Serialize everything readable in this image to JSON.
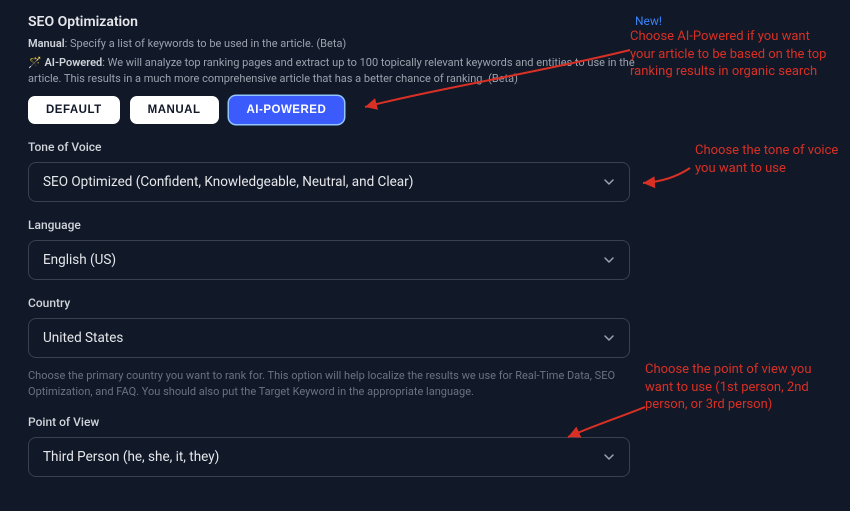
{
  "header": {
    "title": "SEO Optimization",
    "new_badge": "New!"
  },
  "descriptions": {
    "manual_label": "Manual",
    "manual_text": ": Specify a list of keywords to be used in the article. (Beta)",
    "ai_emoji": "🪄",
    "ai_label": "AI-Powered",
    "ai_text": ": We will analyze top ranking pages and extract up to 100 topically relevant keywords and entities to use in the article. This results in a much more comprehensive article that has a better chance of ranking. (Beta)"
  },
  "tabs": {
    "default": "DEFAULT",
    "manual": "MANUAL",
    "ai": "AI-POWERED"
  },
  "fields": {
    "tone_label": "Tone of Voice",
    "tone_value": "SEO Optimized (Confident, Knowledgeable, Neutral, and Clear)",
    "language_label": "Language",
    "language_value": "English (US)",
    "country_label": "Country",
    "country_value": "United States",
    "country_help": "Choose the primary country you want to rank for. This option will help localize the results we use for Real-Time Data, SEO Optimization, and FAQ. You should also put the Target Keyword in the appropriate language.",
    "pov_label": "Point of View",
    "pov_value": "Third Person (he, she, it, they)"
  },
  "annotations": {
    "a1": "Choose AI-Powered if you want your article to be based on the top ranking results in organic search",
    "a2": "Choose the tone of voice you want to use",
    "a3": "Choose the point of view you want to use (1st person, 2nd person, or 3rd person)"
  }
}
